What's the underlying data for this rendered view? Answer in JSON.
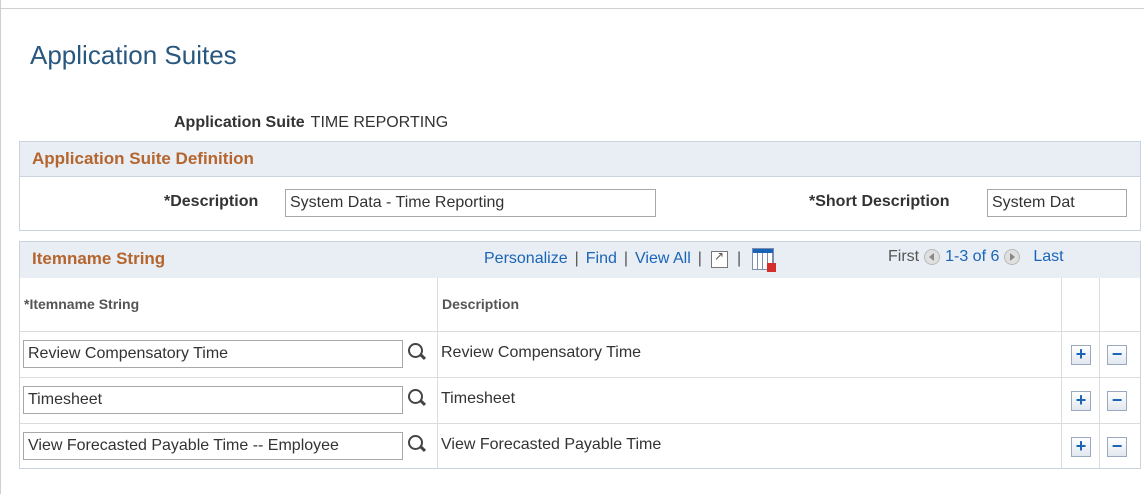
{
  "page": {
    "title": "Application Suites"
  },
  "suite": {
    "label": "Application Suite",
    "value": "TIME REPORTING"
  },
  "definition": {
    "header": "Application Suite Definition",
    "description_label": "*Description",
    "description_value": "System Data - Time Reporting",
    "short_description_label": "*Short Description",
    "short_description_value": "System Dat"
  },
  "grid": {
    "title": "Itemname String",
    "toolbar": {
      "personalize": "Personalize",
      "find": "Find",
      "view_all": "View All",
      "sep": "|"
    },
    "nav": {
      "first": "First",
      "range": "1-3 of 6",
      "last": "Last"
    },
    "columns": {
      "itemname": "*Itemname String",
      "description": "Description"
    },
    "rows": [
      {
        "itemname": "Review Compensatory Time",
        "description": "Review Compensatory Time"
      },
      {
        "itemname": "Timesheet",
        "description": "Timesheet"
      },
      {
        "itemname": "View Forecasted Payable Time -- Employee",
        "description": "View Forecasted Payable Time"
      }
    ],
    "add_label": "+",
    "delete_label": "−"
  }
}
